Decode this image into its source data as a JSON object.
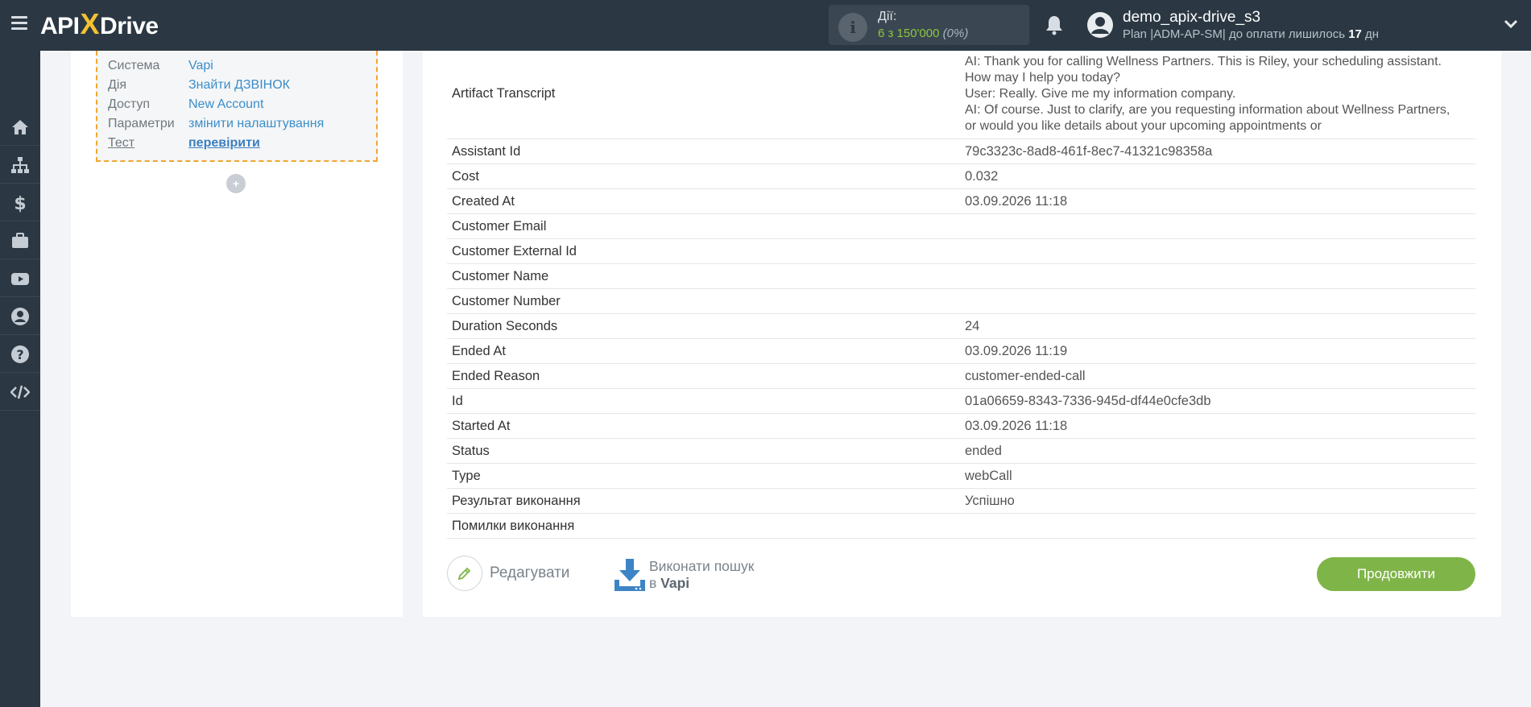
{
  "header": {
    "logo_prefix": "API",
    "logo_x": "X",
    "logo_suffix": "Drive",
    "actions_label": "Дії:",
    "actions_count": "6 з 150'000",
    "actions_percent": "(0%)",
    "username": "demo_apix-drive_s3",
    "plan_text": "Plan |ADM-AP-SM| до оплати лишилось ",
    "plan_days": "17",
    "plan_days_unit": " дн"
  },
  "sidebar": {
    "items": [
      "home-icon",
      "sitemap-icon",
      "dollar-icon",
      "briefcase-icon",
      "youtube-icon",
      "user-icon",
      "question-icon",
      "code-icon"
    ]
  },
  "left_panel": {
    "rows": [
      {
        "key": "Система",
        "value": "Vapi"
      },
      {
        "key": "Дія",
        "value": "Знайти ДЗВІНОК"
      },
      {
        "key": "Доступ",
        "value": "New Account"
      },
      {
        "key": "Параметри",
        "value": "змінити налаштування"
      },
      {
        "key": "Тест",
        "value": "перевірити"
      }
    ],
    "plus": "+"
  },
  "result_table": {
    "transcript_key": "Artifact Transcript",
    "transcript_lines": [
      "AI: Thank you for calling Wellness Partners. This is Riley, your scheduling assistant.",
      "How may I help you today?",
      "User: Really. Give me my information company.",
      "AI: Of course. Just to clarify, are you requesting information about Wellness Partners,",
      "or would you like details about your upcoming appointments or"
    ],
    "rows": [
      {
        "key": "Assistant Id",
        "value": "79c3323c-8ad8-461f-8ec7-41321c98358a"
      },
      {
        "key": "Cost",
        "value": "0.032"
      },
      {
        "key": "Created At",
        "value": "03.09.2026 11:18"
      },
      {
        "key": "Customer Email",
        "value": ""
      },
      {
        "key": "Customer External Id",
        "value": ""
      },
      {
        "key": "Customer Name",
        "value": ""
      },
      {
        "key": "Customer Number",
        "value": ""
      },
      {
        "key": "Duration Seconds",
        "value": "24"
      },
      {
        "key": "Ended At",
        "value": "03.09.2026 11:19"
      },
      {
        "key": "Ended Reason",
        "value": "customer-ended-call"
      },
      {
        "key": "Id",
        "value": "01a06659-8343-7336-945d-df44e0cfe3db"
      },
      {
        "key": "Started At",
        "value": "03.09.2026 11:18"
      },
      {
        "key": "Status",
        "value": "ended"
      },
      {
        "key": "Type",
        "value": "webCall"
      },
      {
        "key": "Результат виконання",
        "value": "Успішно"
      },
      {
        "key": "Помилки виконання",
        "value": ""
      }
    ]
  },
  "buttons": {
    "edit_label": "Редагувати",
    "search_line1": "Виконати пошук",
    "search_line2_prefix": "в ",
    "search_line2_service": "Vapi",
    "continue_label": "Продовжити"
  },
  "colors": {
    "topbar": "#2b3843",
    "accent_green": "#7fb548",
    "link_blue": "#3b8ec9",
    "dashed_orange": "#f0a830",
    "logo_yellow": "#f2c230"
  }
}
